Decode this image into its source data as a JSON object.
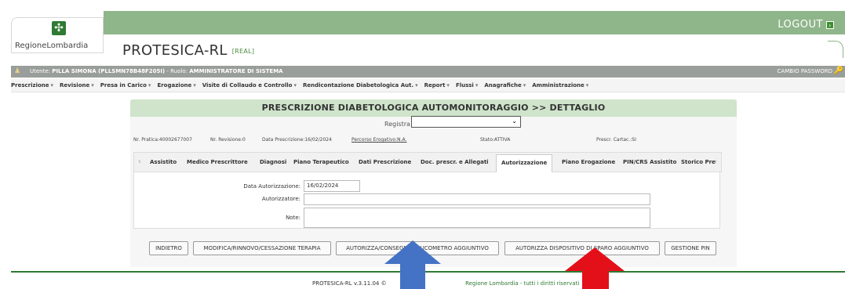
{
  "header": {
    "logo_text": "RegioneLombardia",
    "app_title": "PROTESICA-RL",
    "env_tag": "[REAL]",
    "logout": "LOGOUT"
  },
  "user_bar": {
    "prefix": "Utente:",
    "user": "PILLA SIMONA (PLLSMN78B48F205I)",
    "role_label": "- Ruolo:",
    "role": "AMMINISTRATORE DI SISTEMA",
    "change_password": "CAMBIO PASSWORD"
  },
  "menu": [
    "Prescrizione",
    "Revisione",
    "Presa in Carico",
    "Erogazione",
    "Visite di Collaudo e Controllo",
    "Rendicontazione Diabetologica Aut.",
    "Report",
    "Flussi",
    "Anagrafiche",
    "Amministrazione"
  ],
  "panel": {
    "title": "PRESCRIZIONE DIABETOLOGICA AUTOMONITORAGGIO >> DETTAGLIO",
    "registra_label": "Registra",
    "registra_value": ""
  },
  "info": {
    "pratica": "Nr. Pratica:40002677007",
    "revisione": "Nr. Revisione:0",
    "data_prescr": "Data Prescrizione:16/02/2024",
    "percorso": "Percorso Erogativo:N.A.",
    "stato": "Stato:ATTIVA",
    "prescr_cartac": "Prescr. Cartac.:SI"
  },
  "tabs": [
    "Assistito",
    "Medico Prescrittore",
    "Diagnosi",
    "Piano Terapeutico",
    "Dati Prescrizione",
    "Doc. prescr. e Allegati",
    "Autorizzazione",
    "Piano Erogazione",
    "PIN/CRS Assistito",
    "Storico Pre"
  ],
  "active_tab": "Autorizzazione",
  "form": {
    "data_label": "Data Autorizzazione:",
    "data_value": "16/02/2024",
    "autorizzatore_label": "Autorizzatore:",
    "autorizzatore_value": "",
    "note_label": "Note:",
    "note_value": ""
  },
  "buttons": [
    "INDIETRO",
    "MODIFICA/RINNOVO/CESSAZIONE TERAPIA",
    "AUTORIZZA/CONSEGNA GLUCOMETRO AGGIUNTIVO",
    "AUTORIZZA DISPOSITIVO DI SPARO AGGIUNTIVO",
    "GESTIONE PIN"
  ],
  "footer": {
    "version": "PROTESICA-RL v.3.11.04",
    "copyright": "©",
    "rights": "Regione Lombardia - tutti i diritti riservati"
  },
  "colors": {
    "header_green": "#8fb58a",
    "brand_green": "#2f7a34",
    "user_bar_gray": "#9a9e9a",
    "panel_title_green": "#cfe4cb",
    "arrow_blue": "#4472c4",
    "arrow_red": "#e3101a"
  }
}
